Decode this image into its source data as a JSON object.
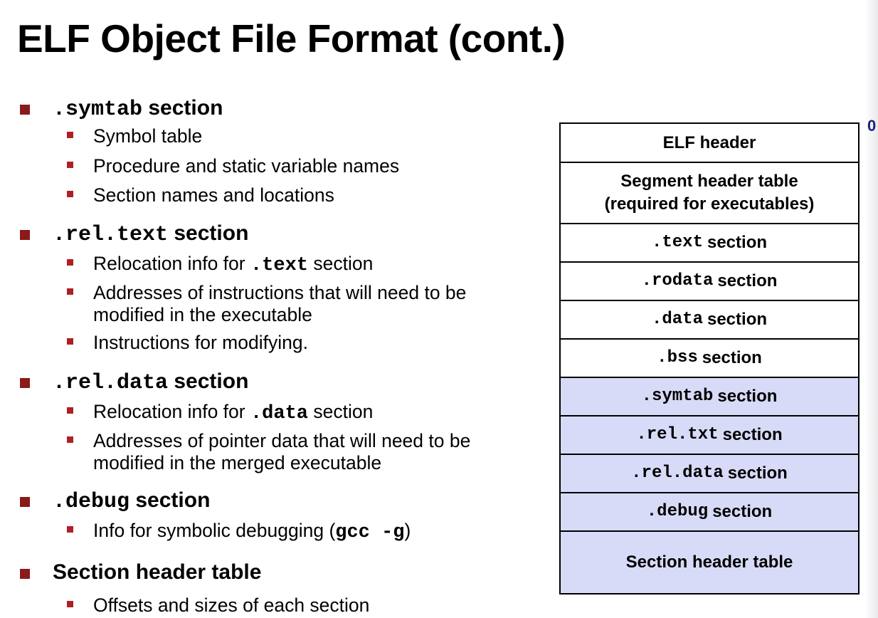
{
  "title": "ELF Object File Format (cont.)",
  "colors": {
    "bullet": "#8b1a1a",
    "sub_bullet": "#b01f24",
    "shaded": "#d8dbf7",
    "offset_label": "#1a237e"
  },
  "bullets": [
    {
      "code": ".symtab",
      "text": "section",
      "subs": [
        {
          "text": "Symbol table"
        },
        {
          "text": "Procedure and static variable names"
        },
        {
          "text": "Section names and locations"
        }
      ]
    },
    {
      "code": ".rel.text",
      "text": "section",
      "subs": [
        {
          "pre": "Relocation info for",
          "code": ".text",
          "post": "section"
        },
        {
          "line1": "Addresses of instructions that will need to be",
          "line2": "modified in the executable"
        },
        {
          "text": "Instructions for modifying."
        }
      ]
    },
    {
      "code": ".rel.data",
      "text": "section",
      "subs": [
        {
          "pre": "Relocation info for",
          "code": ".data",
          "post": "section"
        },
        {
          "line1": "Addresses of pointer data that will need to be",
          "line2": "modified in the merged executable"
        }
      ]
    },
    {
      "code": ".debug",
      "text": "section",
      "subs": [
        {
          "pre": "Info for symbolic debugging (",
          "code": "gcc -g",
          "post": ")"
        }
      ]
    },
    {
      "text": "Section header table",
      "subs": [
        {
          "text": "Offsets and sizes of each section"
        }
      ]
    }
  ],
  "diagram": {
    "offset_label": "0",
    "rows": [
      {
        "label": "ELF header"
      },
      {
        "line1": "Segment header table",
        "line2": "(required for executables)"
      },
      {
        "code": ".text",
        "label": "section"
      },
      {
        "code": ".rodata",
        "label": "section"
      },
      {
        "code": ".data",
        "label": "section"
      },
      {
        "code": ".bss",
        "label": "section"
      },
      {
        "code": ".symtab",
        "label": "section"
      },
      {
        "code": ".rel.txt",
        "label": "section"
      },
      {
        "code": ".rel.data",
        "label": "section"
      },
      {
        "code": ".debug",
        "label": "section"
      },
      {
        "label": "Section header table"
      }
    ]
  }
}
